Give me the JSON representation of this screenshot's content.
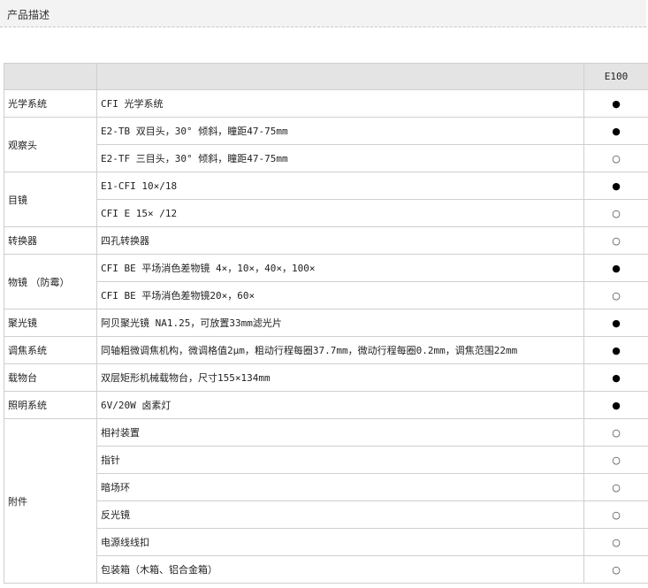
{
  "header": {
    "title": "产品描述"
  },
  "table": {
    "model": "E100",
    "groups": [
      {
        "category": "光学系统",
        "rows": [
          {
            "desc": "CFI 光学系统",
            "mark": "●"
          }
        ]
      },
      {
        "category": "观察头",
        "rows": [
          {
            "desc": "E2-TB 双目头，30° 倾斜，瞳距47-75mm",
            "mark": "●"
          },
          {
            "desc": "E2-TF 三目头，30° 倾斜，瞳距47-75mm",
            "mark": "○"
          }
        ]
      },
      {
        "category": "目镜",
        "rows": [
          {
            "desc": "E1-CFI  10×/18",
            "mark": "●"
          },
          {
            "desc": "CFI  E  15×  /12",
            "mark": "○"
          }
        ]
      },
      {
        "category": "转换器",
        "rows": [
          {
            "desc": "四孔转换器",
            "mark": "○"
          }
        ]
      },
      {
        "category": "物镜  （防霉）",
        "rows": [
          {
            "desc": "CFI  BE  平场消色差物镜  4×，10×，40×，100×",
            "mark": "●"
          },
          {
            "desc": "CFI  BE 平场消色差物镜20×，60×",
            "mark": "○"
          }
        ]
      },
      {
        "category": "聚光镜",
        "rows": [
          {
            "desc": "阿贝聚光镜  NA1.25，可放置33mm滤光片",
            "mark": "●"
          }
        ]
      },
      {
        "category": "调焦系统",
        "rows": [
          {
            "desc": "同轴粗微调焦机构，微调格值2μm，粗动行程每圈37.7mm，微动行程每圈0.2mm，调焦范围22mm",
            "mark": "●"
          }
        ]
      },
      {
        "category": "载物台",
        "rows": [
          {
            "desc": "双层矩形机械载物台，尺寸155×134mm",
            "mark": "●"
          }
        ]
      },
      {
        "category": "照明系统",
        "rows": [
          {
            "desc": "6V/20W  卤素灯",
            "mark": "●"
          }
        ]
      },
      {
        "category": "附件",
        "rows": [
          {
            "desc": "相衬装置",
            "mark": "○"
          },
          {
            "desc": "指针",
            "mark": "○"
          },
          {
            "desc": "暗场环",
            "mark": "○"
          },
          {
            "desc": "反光镜",
            "mark": "○"
          },
          {
            "desc": "电源线线扣",
            "mark": "○"
          },
          {
            "desc": "包装箱（木箱、铝合金箱）",
            "mark": "○"
          }
        ]
      }
    ]
  }
}
